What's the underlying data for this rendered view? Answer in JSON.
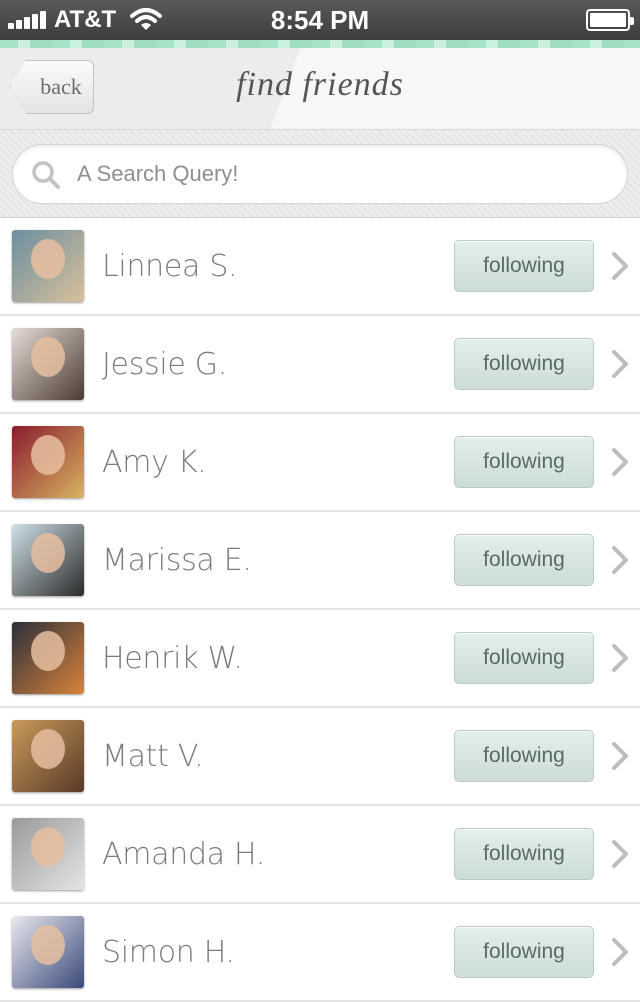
{
  "status_bar": {
    "carrier": "AT&T",
    "time": "8:54 PM"
  },
  "nav": {
    "back_label": "back",
    "title": "find friends"
  },
  "search": {
    "placeholder": "A Search Query!"
  },
  "friends": [
    {
      "name": "Linnea S.",
      "action": "following",
      "avatar_colors": [
        "#6b8fa0",
        "#d8c09a"
      ]
    },
    {
      "name": "Jessie G.",
      "action": "following",
      "avatar_colors": [
        "#e7ddd6",
        "#4a3a34"
      ]
    },
    {
      "name": "Amy K.",
      "action": "following",
      "avatar_colors": [
        "#8a1b2e",
        "#d8b460"
      ]
    },
    {
      "name": "Marissa E.",
      "action": "following",
      "avatar_colors": [
        "#cfe0e8",
        "#2a2a2a"
      ]
    },
    {
      "name": "Henrik W.",
      "action": "following",
      "avatar_colors": [
        "#2b2f3a",
        "#d9823a"
      ]
    },
    {
      "name": "Matt V.",
      "action": "following",
      "avatar_colors": [
        "#c89a5a",
        "#5a3a28"
      ]
    },
    {
      "name": "Amanda H.",
      "action": "following",
      "avatar_colors": [
        "#9a9a9a",
        "#e4e4e4"
      ]
    },
    {
      "name": "Simon H.",
      "action": "following",
      "avatar_colors": [
        "#e9e9ef",
        "#3a4a7a"
      ]
    }
  ],
  "colors": {
    "accent_mint": "#a6e3c6",
    "follow_button": "#d6e7df"
  }
}
